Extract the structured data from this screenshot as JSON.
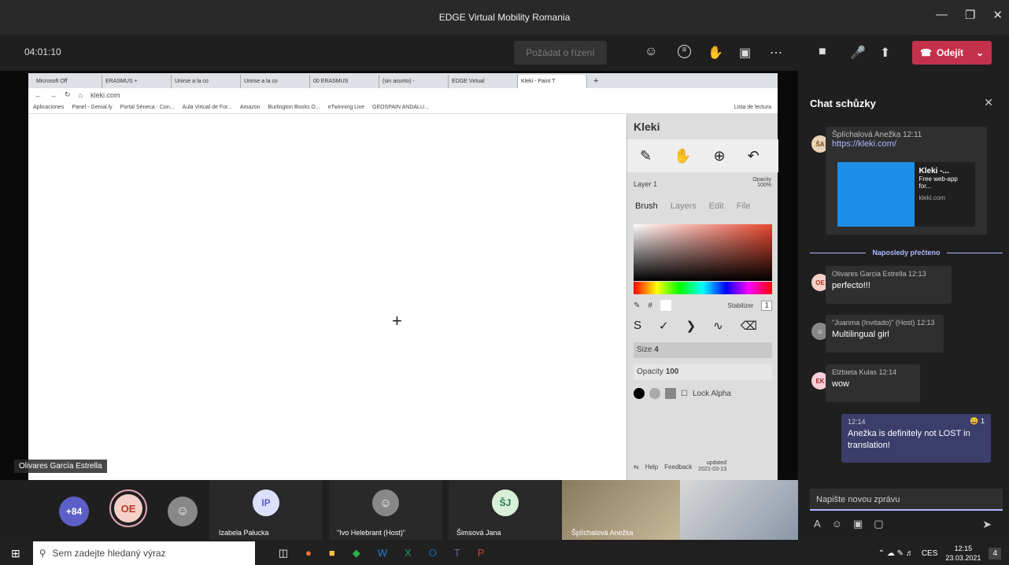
{
  "window": {
    "title": "EDGE Virtual Mobility Romania"
  },
  "meeting": {
    "timer": "04:01:10",
    "request_control": "Požádat o řízení",
    "leave": "Odejít"
  },
  "browser": {
    "tabs": [
      "Microsoft Off",
      "ERASMUS +",
      "Unirse a la co",
      "Unirse a la co",
      "00 ERASMUS",
      "(sin asunto) -",
      "EDGE Virtual",
      "Kleki - Paint T"
    ],
    "url": "kleki.com",
    "bookmarks": [
      "Aplicaciones",
      "Panel - Genial.ly",
      "Portal Séneca - Con...",
      "Aula Virtual de For...",
      "Amazon",
      "Burlington Books O...",
      "eTwinning Live",
      "GEOSPAIN ANDALU..."
    ],
    "reading_list": "Lista de lectura"
  },
  "kleki": {
    "brand": "Kleki",
    "layer": "Layer 1",
    "opacity_label": "Opacity",
    "opacity_val": "100%",
    "tabs": [
      "Brush",
      "Layers",
      "Edit",
      "File"
    ],
    "stabilizer": "Stabilizer",
    "stab_val": "1",
    "size_label": "Size",
    "size_val": "4",
    "op_label": "Opacity",
    "op_val": "100",
    "lock_alpha": "Lock Alpha",
    "help": "Help",
    "feedback": "Feedback",
    "updated": "updated",
    "updated_date": "2021-03-13",
    "accent": "#e8472f"
  },
  "speaker_label": "Olivares García Estrella",
  "chat": {
    "title": "Chat schůzky",
    "last_read": "Naposledy přečteno",
    "messages": [
      {
        "initials": "ŠA",
        "name": "Šplíchalová Anežka",
        "time": "12:11",
        "text": "https://kleki.com/",
        "preview_title": "Kleki -...",
        "preview_desc": "Free web-app for...",
        "preview_site": "kleki.com"
      },
      {
        "initials": "OE",
        "name": "Olivares Garcia Estrella",
        "time": "12:13",
        "text": "perfecto!!!"
      },
      {
        "initials": "",
        "name": "\"Juanma (Invitado)\" (Host)",
        "time": "12:13",
        "text": "Multilingual girl"
      },
      {
        "initials": "EK",
        "name": "Elżbieta Kulas",
        "time": "12:14",
        "text": "wow"
      },
      {
        "initials": "",
        "name": "",
        "time": "12:14",
        "text": "Anežka is definitely not LOST in translation!",
        "reaction": "1"
      }
    ],
    "input_placeholder": "Napište novou zprávu"
  },
  "participants": {
    "more": "+84",
    "oe": "OE",
    "ip": "IP",
    "sj": "ŠJ",
    "names": [
      "Izabela Pałucka",
      "\"Ivo Helebrant (Host)\"",
      "Šimsová Jana",
      "Šplíchalová Anežka"
    ]
  },
  "taskbar": {
    "search": "Sem zadejte hledaný výraz",
    "lang": "CES",
    "time": "12:15",
    "date": "23.03.2021",
    "notif": "4"
  }
}
